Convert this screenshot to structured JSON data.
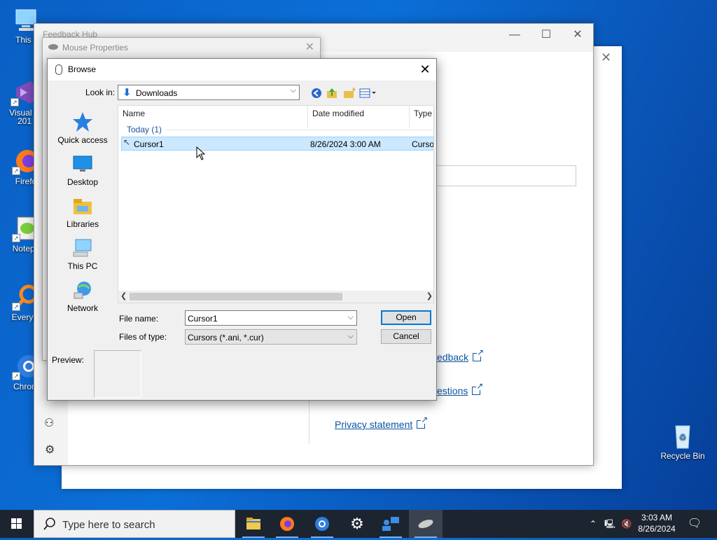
{
  "desktop": {
    "icons": [
      {
        "label": "This P"
      },
      {
        "label": "Visual S"
      },
      {
        "label": "201"
      },
      {
        "label": "Firefo"
      },
      {
        "label": "Notepa"
      },
      {
        "label": "Everyth"
      },
      {
        "label": "Chrom"
      },
      {
        "label": "Recycle Bin"
      }
    ]
  },
  "feedback_hub": {
    "title": "Feedback Hub",
    "links": [
      "edback",
      "estions",
      "Privacy statement"
    ]
  },
  "mouse_properties": {
    "title": "Mouse Properties"
  },
  "browse_dialog": {
    "title": "Browse",
    "look_in_label": "Look in:",
    "look_in_value": "Downloads",
    "places": [
      "Quick access",
      "Desktop",
      "Libraries",
      "This PC",
      "Network"
    ],
    "columns": [
      "Name",
      "Date modified",
      "Type"
    ],
    "group_header": "Today (1)",
    "files": [
      {
        "name": "Cursor1",
        "date": "8/26/2024 3:00 AM",
        "type": "Curso"
      }
    ],
    "file_name_label": "File name:",
    "file_name_value": "Cursor1",
    "file_type_label": "Files of type:",
    "file_type_value": "Cursors (*.ani, *.cur)",
    "open_label": "Open",
    "cancel_label": "Cancel",
    "preview_label": "Preview:"
  },
  "taskbar": {
    "search_placeholder": "Type here to search",
    "time": "3:03 AM",
    "date": "8/26/2024"
  },
  "colors": {
    "accent": "#0078d7",
    "selection": "#cce8ff",
    "desktop": "#0b6fd8",
    "taskbar": "#1c2430"
  }
}
